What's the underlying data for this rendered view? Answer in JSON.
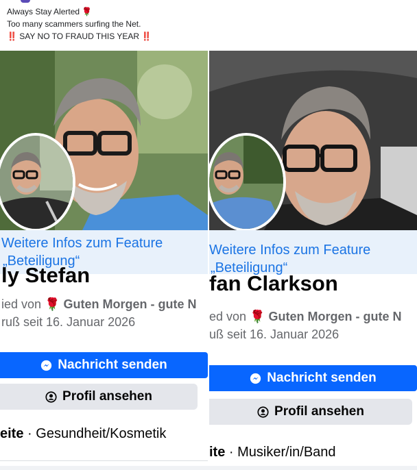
{
  "post": {
    "line1": "Always Stay Alerted",
    "line2": "Too many scammers surfing the Net.",
    "line3": "SAY NO TO FRAUD THIS YEAR",
    "alert_emoji": "‼️",
    "rose_emoji": "🌹"
  },
  "left": {
    "banner_line1": "Weitere Infos zum Feature",
    "banner_line2": "Beteiligung“",
    "banner_prefix": "„",
    "name": "ly Stefan",
    "sub1_prefix": "ied von",
    "sub1_page": "Guten Morgen - gute N",
    "sub2": "ruß seit 16. Januar 2026",
    "message_button": "Nachricht senden",
    "profile_button": "Profil ansehen",
    "category_prefix": "eite",
    "category": "Gesundheit/Kosmetik"
  },
  "right": {
    "banner_line1": "Weitere Infos zum Feature",
    "banner_line2": "Beteiligung“",
    "name": "fan Clarkson",
    "sub1_prefix": "ed von",
    "sub1_page": "Guten Morgen - gute N",
    "sub2": "uß seit 16. Januar 2026",
    "message_button": "Nachricht senden",
    "profile_button": "Profil ansehen",
    "category_prefix": "ite",
    "category": "Musiker/in/Band"
  },
  "separator": "·",
  "colors": {
    "facebook_blue": "#0866ff",
    "link_blue": "#1b74e4",
    "banner_bg": "#e8f1fb",
    "button_gray": "#e4e6eb",
    "secondary_text": "#65676b"
  }
}
